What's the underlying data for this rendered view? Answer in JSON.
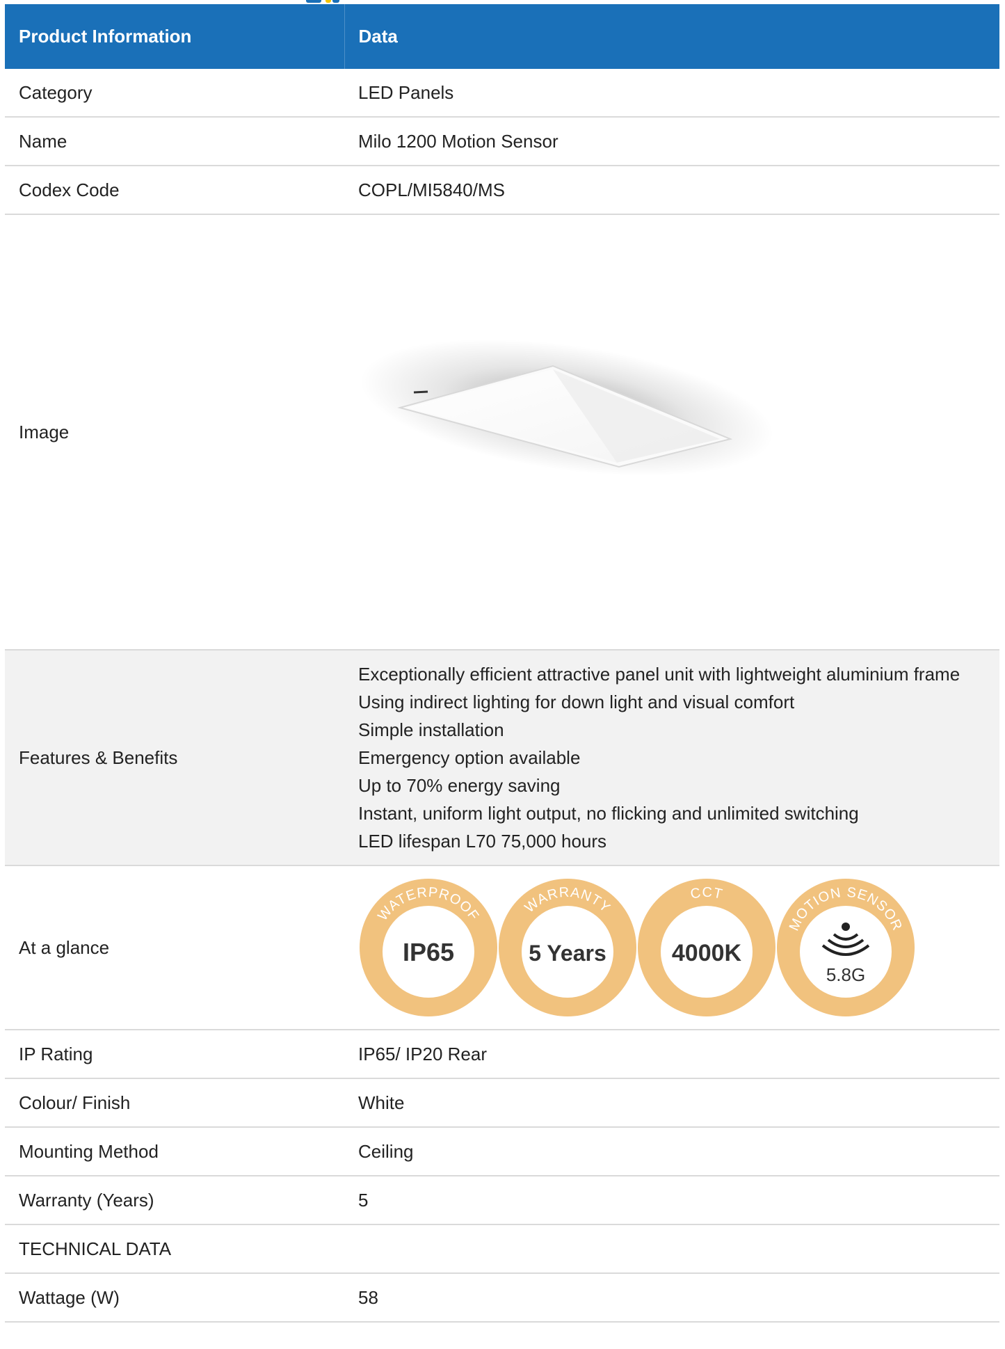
{
  "table": {
    "header": {
      "col1": "Product Information",
      "col2": "Data"
    },
    "rows": {
      "category": {
        "label": "Category",
        "value": "LED Panels"
      },
      "name": {
        "label": "Name",
        "value": "Milo 1200 Motion Sensor"
      },
      "codex": {
        "label": "Codex Code",
        "value": "COPL/MI5840/MS"
      },
      "image": {
        "label": "Image"
      },
      "features": {
        "label": "Features & Benefits",
        "items": [
          "Exceptionally efficient attractive panel unit with lightweight aluminium frame",
          "Using indirect lighting for down light and visual comfort",
          "Simple installation",
          "Emergency option available",
          "Up to 70% energy saving",
          "Instant, uniform light output, no flicking and unlimited switching",
          "LED lifespan L70 75,000 hours"
        ]
      },
      "glance": {
        "label": "At a glance",
        "badges": [
          {
            "ring": "WATERPROOF",
            "center": "IP65"
          },
          {
            "ring": "WARRANTY",
            "center": "5 Years"
          },
          {
            "ring": "CCT",
            "center": "4000K"
          },
          {
            "ring": "MOTION SENSOR",
            "center": "5.8G"
          }
        ]
      },
      "ip": {
        "label": "IP Rating",
        "value": "IP65/ IP20 Rear"
      },
      "colour": {
        "label": "Colour/ Finish",
        "value": "White"
      },
      "mounting": {
        "label": "Mounting Method",
        "value": "Ceiling"
      },
      "warranty": {
        "label": "Warranty (Years)",
        "value": "5"
      },
      "technical": {
        "label": "TECHNICAL DATA"
      },
      "wattage": {
        "label": "Wattage (W)",
        "value": "58"
      }
    }
  },
  "colors": {
    "header_bg": "#1a70b8",
    "alt_row": "#f2f2f2",
    "badge_ring": "#f1c27e"
  }
}
